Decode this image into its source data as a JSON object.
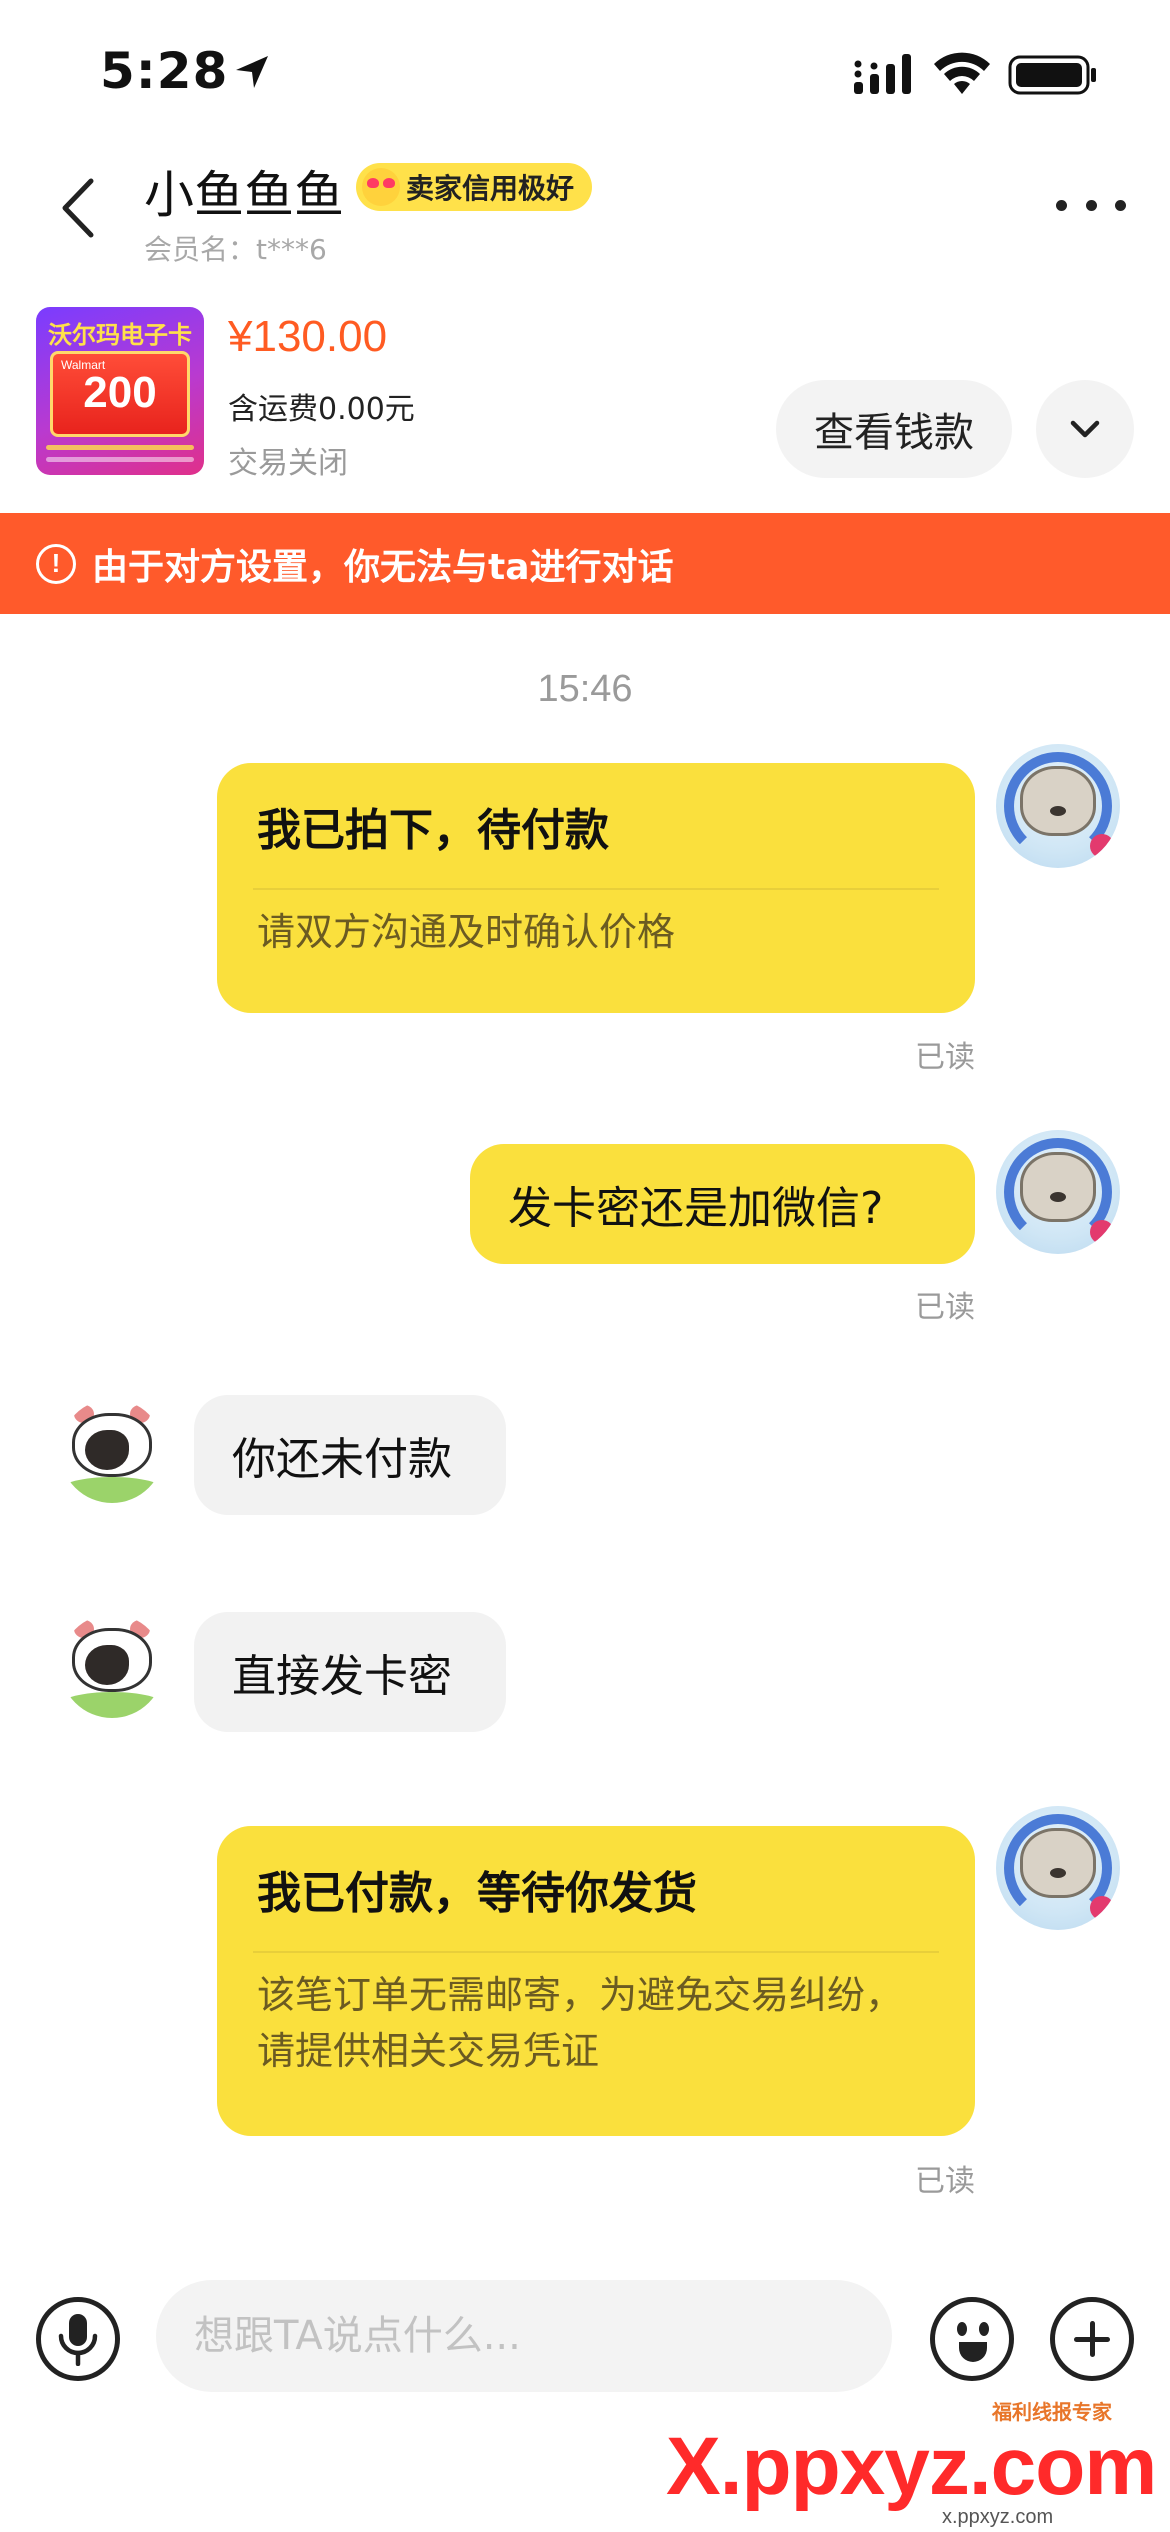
{
  "status_bar": {
    "time": "5:28"
  },
  "header": {
    "seller_name": "小鱼鱼鱼",
    "badge": "卖家信用极好",
    "member_name": "会员名：t***6"
  },
  "product": {
    "thumb_title": "沃尔玛电子卡",
    "thumb_brand": "Walmart",
    "thumb_value": "200",
    "price": "¥130.00",
    "shipping": "含运费0.00元",
    "status": "交易关闭",
    "view_button": "查看钱款"
  },
  "warning": "由于对方设置，你无法与ta进行对话",
  "chat": {
    "timestamp": "15:46",
    "messages": [
      {
        "from": "me",
        "title": "我已拍下，待付款",
        "body": "请双方沟通及时确认价格",
        "read": "已读"
      },
      {
        "from": "me",
        "text": "发卡密还是加微信?",
        "read": "已读"
      },
      {
        "from": "them",
        "text": "你还未付款"
      },
      {
        "from": "them",
        "text": "直接发卡密"
      },
      {
        "from": "me",
        "title": "我已付款，等待你发货",
        "body": "该笔订单无需邮寄，为避免交易纠纷，请提供相关交易凭证",
        "read": "已读"
      }
    ]
  },
  "input": {
    "placeholder": "想跟TA说点什么..."
  },
  "watermark": {
    "main": "X.ppxyz.com",
    "sub": "福利线报专家",
    "small": "x.ppxyz.com"
  },
  "colors": {
    "accent": "#ff5a2b",
    "bubble_out": "#fae03d",
    "bubble_in": "#f2f2f2",
    "price": "#ff5b22"
  }
}
